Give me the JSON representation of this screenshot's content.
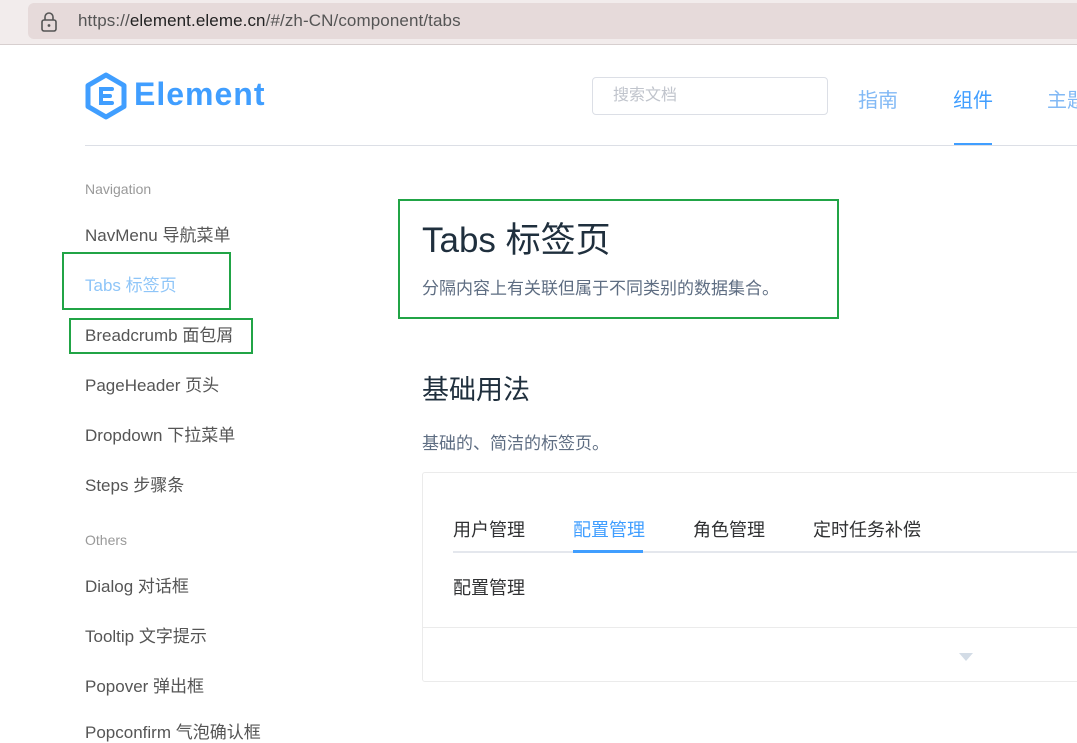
{
  "browser": {
    "url_prefix": "https://",
    "url_host": "element.eleme.cn",
    "url_path": "/#/zh-CN/component/tabs",
    "lock_icon": "lock-icon"
  },
  "header": {
    "logo_text": "Element",
    "logo_icon": "element-logo-icon",
    "search_placeholder": "搜索文档",
    "nav": [
      "指南",
      "组件",
      "主题"
    ]
  },
  "sidebar": {
    "group_navigation": "Navigation",
    "navigation_items": [
      "NavMenu 导航菜单",
      "Tabs 标签页",
      "Breadcrumb 面包屑",
      "PageHeader 页头",
      "Dropdown 下拉菜单",
      "Steps 步骤条"
    ],
    "group_others": "Others",
    "others_items": [
      "Dialog 对话框",
      "Tooltip 文字提示",
      "Popover 弹出框",
      "Popconfirm 气泡确认框"
    ]
  },
  "main": {
    "title": "Tabs 标签页",
    "description": "分隔内容上有关联但属于不同类别的数据集合。",
    "section_title": "基础用法",
    "section_desc": "基础的、简洁的标签页。",
    "tabs": [
      "用户管理",
      "配置管理",
      "角色管理",
      "定时任务补偿"
    ],
    "active_tab": "配置管理",
    "tab_content": "配置管理"
  },
  "colors": {
    "accent": "#409eff",
    "highlight_box": "#21a446"
  }
}
